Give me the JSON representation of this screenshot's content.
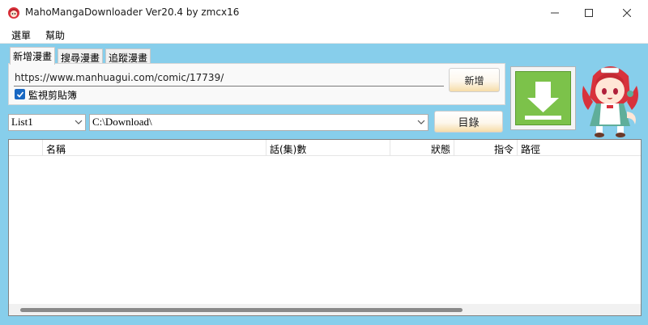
{
  "window": {
    "title": "MahoMangaDownloader Ver20.4 by zmcx16"
  },
  "menu": {
    "items": [
      "選單",
      "幫助"
    ]
  },
  "tabs": [
    {
      "label": "新增漫畫",
      "active": true
    },
    {
      "label": "搜尋漫畫",
      "active": false
    },
    {
      "label": "追蹤漫畫",
      "active": false
    }
  ],
  "add_panel": {
    "url_value": "https://www.manhuagui.com/comic/17739/",
    "add_button": "新增",
    "monitor_clipboard_label": "監視剪貼簿",
    "monitor_clipboard_checked": true
  },
  "controls": {
    "list_select_value": "List1",
    "path_select_value": "C:\\Download\\",
    "directory_button": "目錄"
  },
  "table": {
    "columns": [
      "",
      "名稱",
      "話(集)數",
      "狀態",
      "指令",
      "路徑"
    ],
    "rows": []
  },
  "icons": {
    "app": "maho-app-icon",
    "download": "download-arrow-icon",
    "mascot": "maho-mascot-image"
  },
  "colors": {
    "background": "#87ceeb",
    "download_green": "#7cc24a",
    "checkbox_blue": "#1767c2"
  }
}
